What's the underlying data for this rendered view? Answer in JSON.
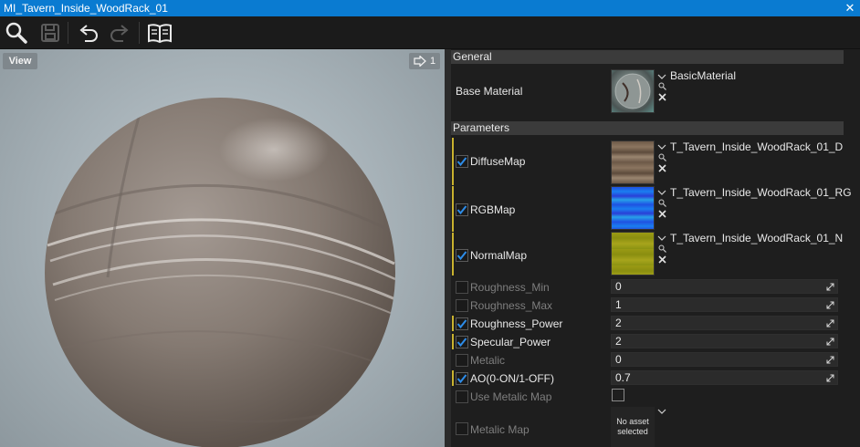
{
  "window": {
    "title": "MI_Tavern_Inside_WoodRack_01"
  },
  "toolbar": {
    "icons": [
      "search-icon",
      "save-icon",
      "undo-icon",
      "redo-icon",
      "docs-book-icon"
    ]
  },
  "viewport": {
    "view_label": "View",
    "camera_count": "1"
  },
  "general": {
    "header": "General",
    "base_material_label": "Base Material",
    "base_material_value": "BasicMaterial"
  },
  "parameters": {
    "header": "Parameters",
    "textures": [
      {
        "label": "DiffuseMap",
        "value": "T_Tavern_Inside_WoodRack_01_D",
        "checked": true
      },
      {
        "label": "RGBMap",
        "value": "T_Tavern_Inside_WoodRack_01_RG",
        "checked": true
      },
      {
        "label": "NormalMap",
        "value": "T_Tavern_Inside_WoodRack_01_N",
        "checked": true
      }
    ],
    "scalars": [
      {
        "label": "Roughness_Min",
        "value": "0",
        "checked": false
      },
      {
        "label": "Roughness_Max",
        "value": "1",
        "checked": false
      },
      {
        "label": "Roughness_Power",
        "value": "2",
        "checked": true
      },
      {
        "label": "Specular_Power",
        "value": "2",
        "checked": true
      },
      {
        "label": "Metalic",
        "value": "0",
        "checked": false
      },
      {
        "label": "AO(0-ON/1-OFF)",
        "value": "0.7",
        "checked": true
      }
    ],
    "use_metalic_map": {
      "label": "Use Metalic Map",
      "checked": false
    },
    "metalic_map": {
      "label": "Metalic Map",
      "placeholder": "No asset selected",
      "checked": false
    }
  },
  "colors": {
    "accent": "#0a7bd1",
    "check_blue": "#2d8ce8",
    "override_bar": "#c9b22e"
  }
}
